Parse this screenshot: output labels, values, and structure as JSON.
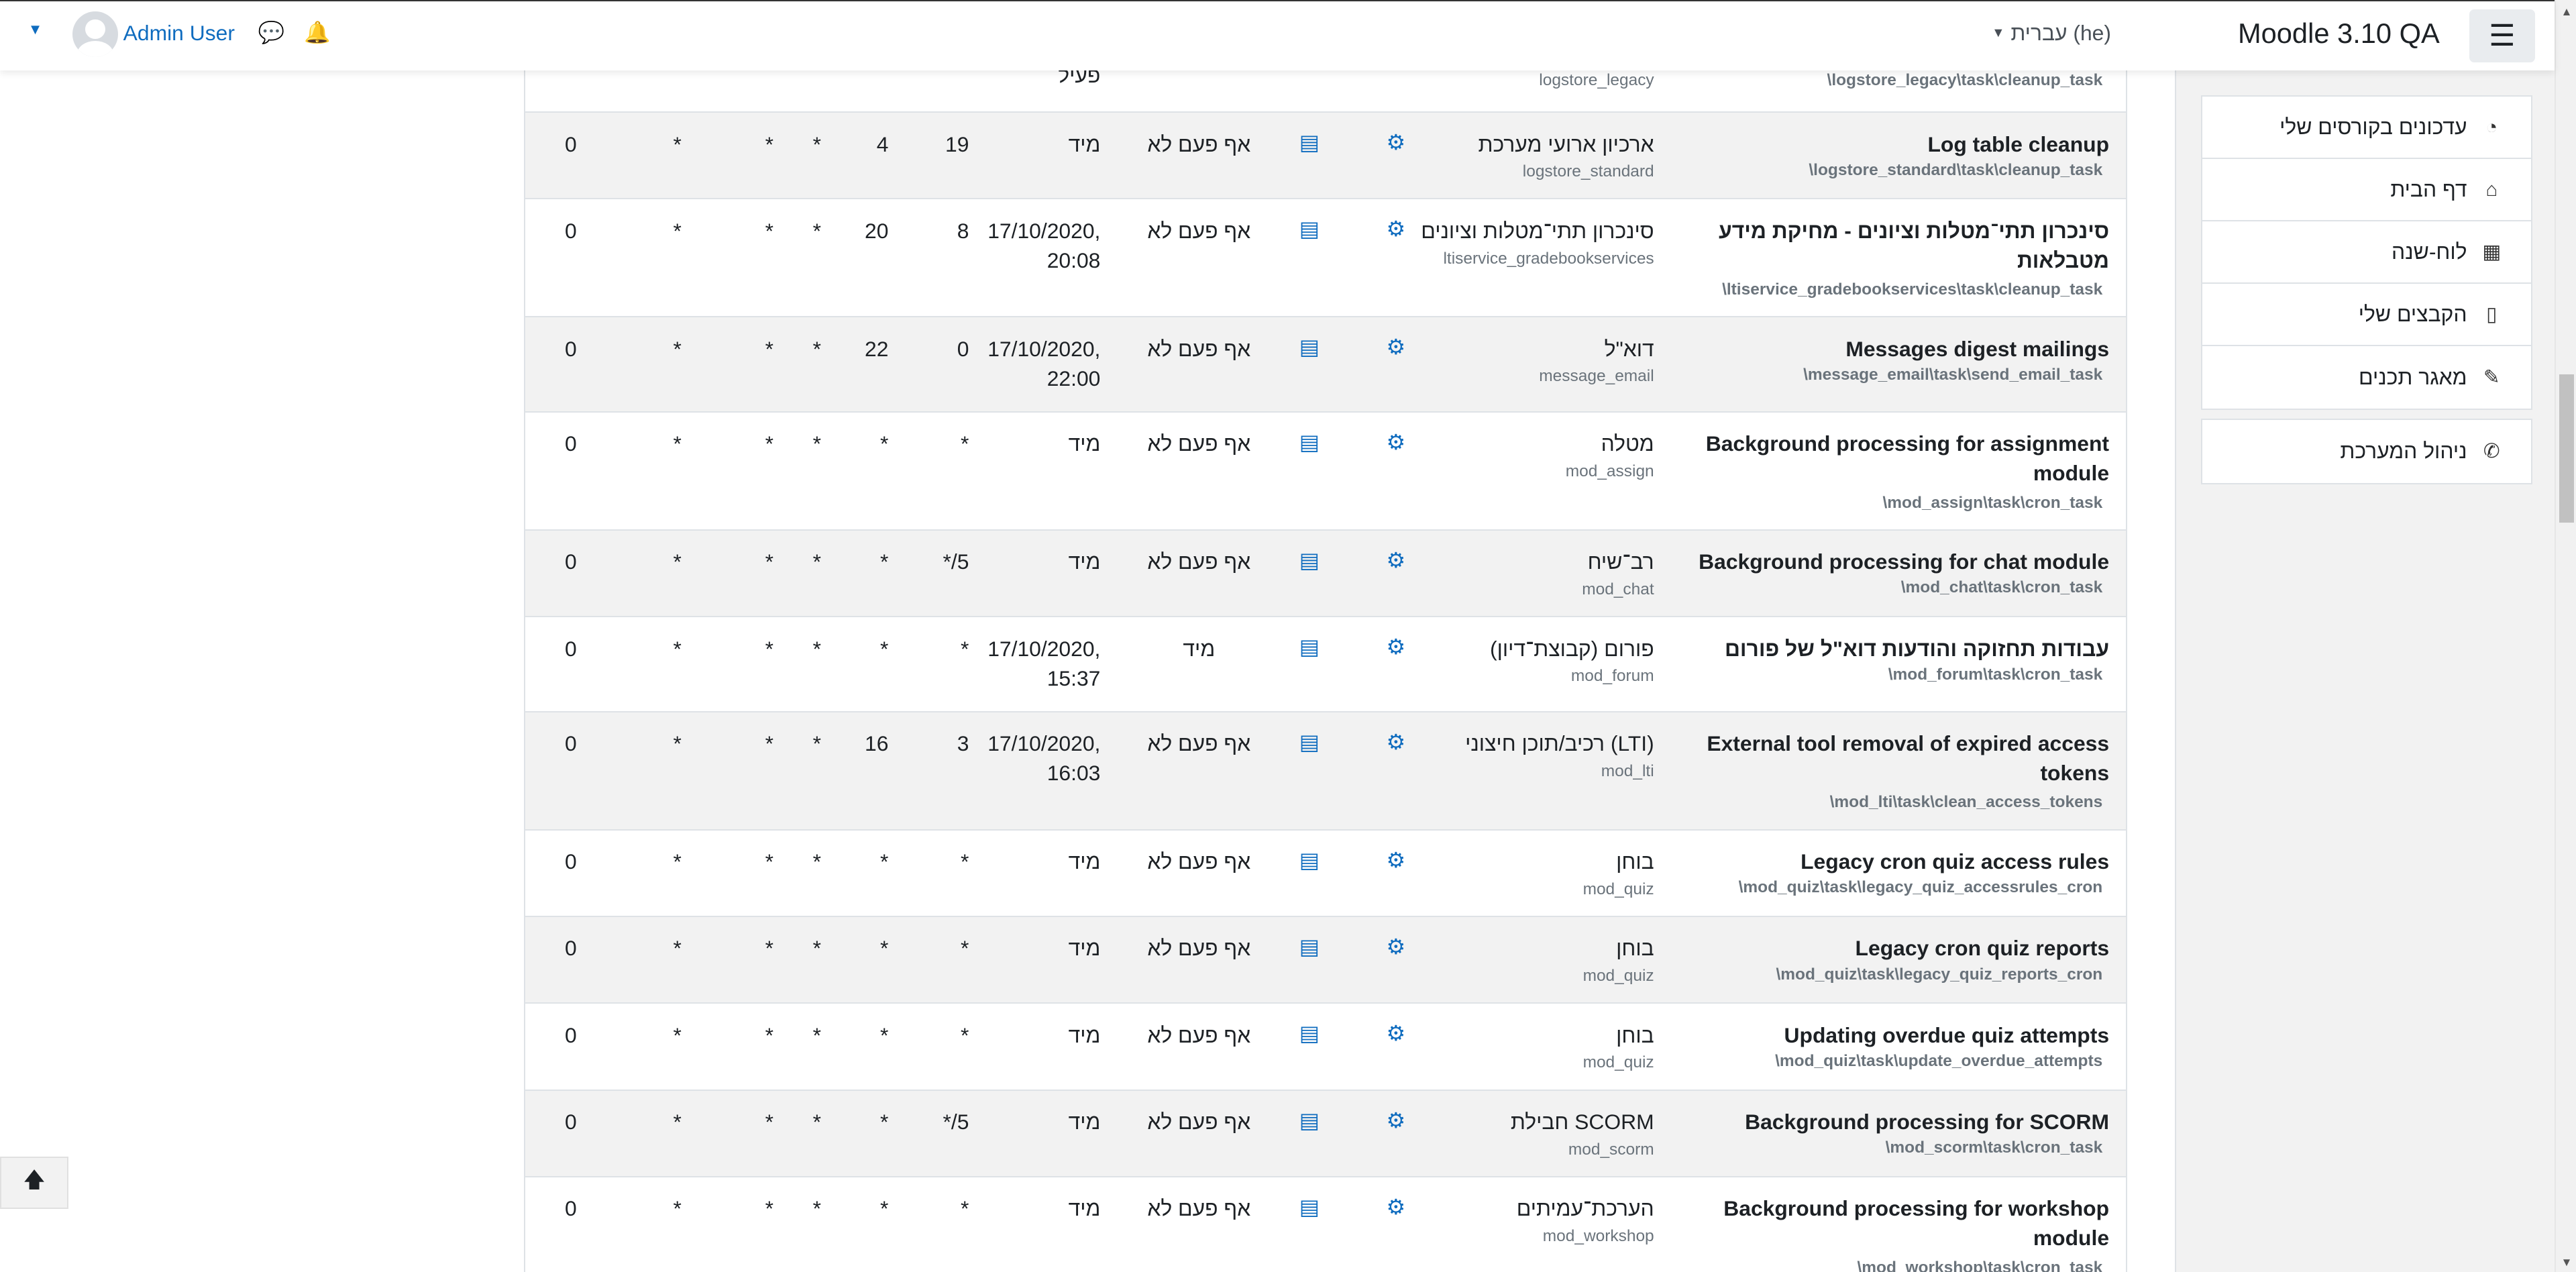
{
  "navbar": {
    "brand": "Moodle 3.10 QA",
    "language": "עברית (he)",
    "user": "Admin User"
  },
  "drawer": {
    "group1": [
      {
        "label": "עדכונים בקורסים שלי",
        "icon": "dashboard-icon",
        "glyph": "◔"
      },
      {
        "label": "דף הבית",
        "icon": "home-icon",
        "glyph": "⌂"
      },
      {
        "label": "לוח-שנה",
        "icon": "calendar-icon",
        "glyph": "▦"
      },
      {
        "label": "הקבצים שלי",
        "icon": "file-icon",
        "glyph": "▯"
      },
      {
        "label": "מאגר תכנים",
        "icon": "paintbrush-icon",
        "glyph": "✎"
      }
    ],
    "group2": [
      {
        "label": "ניהול המערכת",
        "icon": "wrench-icon",
        "glyph": "✆"
      }
    ]
  },
  "table": {
    "partial_row": {
      "path": "\\logstore_legacy\\task\\cleanup_task",
      "component_sub": "logstore_legacy",
      "status": "פעיל"
    },
    "rows": [
      {
        "name": "Log table cleanup",
        "path": "\\logstore_standard\\task\\cleanup_task",
        "component": "ארכיון ארועי מערכת",
        "component_sub": "logstore_standard",
        "last": "אף פעם לא",
        "next": "מיד",
        "next2": "",
        "minute": "19",
        "hour": "4",
        "day": "*",
        "dow": "*",
        "month": "*",
        "fail": "0"
      },
      {
        "name": "סינכרון תתי־מטלות וציונים - מחיקת מידע מטבלאות",
        "path": "\\ltiservice_gradebookservices\\task\\cleanup_task",
        "component": "סינכרון תתי־מטלות וציונים",
        "component_sub": "ltiservice_gradebookservices",
        "last": "אף פעם לא",
        "next": "17/10/2020,",
        "next2": "20:08",
        "minute": "8",
        "hour": "20",
        "day": "*",
        "dow": "*",
        "month": "*",
        "fail": "0"
      },
      {
        "name": "Messages digest mailings",
        "path": "\\message_email\\task\\send_email_task",
        "component": "דוא\"ל",
        "component_sub": "message_email",
        "last": "אף פעם לא",
        "next": "17/10/2020,",
        "next2": "22:00",
        "minute": "0",
        "hour": "22",
        "day": "*",
        "dow": "*",
        "month": "*",
        "fail": "0"
      },
      {
        "name": "Background processing for assignment module",
        "path": "\\mod_assign\\task\\cron_task",
        "component": "מטלה",
        "component_sub": "mod_assign",
        "last": "אף פעם לא",
        "next": "מיד",
        "next2": "",
        "minute": "*",
        "hour": "*",
        "day": "*",
        "dow": "*",
        "month": "*",
        "fail": "0"
      },
      {
        "name": "Background processing for chat module",
        "path": "\\mod_chat\\task\\cron_task",
        "component": "רב־שיח",
        "component_sub": "mod_chat",
        "last": "אף פעם לא",
        "next": "מיד",
        "next2": "",
        "minute": "*/5",
        "hour": "*",
        "day": "*",
        "dow": "*",
        "month": "*",
        "fail": "0"
      },
      {
        "name": "עבודות תחזוקה והודעות דוא\"ל של פורום",
        "path": "\\mod_forum\\task\\cron_task",
        "component": "פורום (קבוצת־דיון)",
        "component_sub": "mod_forum",
        "last": "מיד",
        "next": "17/10/2020,",
        "next2": "15:37",
        "minute": "*",
        "hour": "*",
        "day": "*",
        "dow": "*",
        "month": "*",
        "fail": "0",
        "swap": true
      },
      {
        "name": "External tool removal of expired access tokens",
        "path": "\\mod_lti\\task\\clean_access_tokens",
        "component": "רכיב/תוכן חיצוני (LTI)",
        "component_sub": "mod_lti",
        "last": "אף פעם לא",
        "next": "17/10/2020,",
        "next2": "16:03",
        "minute": "3",
        "hour": "16",
        "day": "*",
        "dow": "*",
        "month": "*",
        "fail": "0"
      },
      {
        "name": "Legacy cron quiz access rules",
        "path": "\\mod_quiz\\task\\legacy_quiz_accessrules_cron",
        "component": "בוחן",
        "component_sub": "mod_quiz",
        "last": "אף פעם לא",
        "next": "מיד",
        "next2": "",
        "minute": "*",
        "hour": "*",
        "day": "*",
        "dow": "*",
        "month": "*",
        "fail": "0"
      },
      {
        "name": "Legacy cron quiz reports",
        "path": "\\mod_quiz\\task\\legacy_quiz_reports_cron",
        "component": "בוחן",
        "component_sub": "mod_quiz",
        "last": "אף פעם לא",
        "next": "מיד",
        "next2": "",
        "minute": "*",
        "hour": "*",
        "day": "*",
        "dow": "*",
        "month": "*",
        "fail": "0"
      },
      {
        "name": "Updating overdue quiz attempts",
        "path": "\\mod_quiz\\task\\update_overdue_attempts",
        "component": "בוחן",
        "component_sub": "mod_quiz",
        "last": "אף פעם לא",
        "next": "מיד",
        "next2": "",
        "minute": "*",
        "hour": "*",
        "day": "*",
        "dow": "*",
        "month": "*",
        "fail": "0"
      },
      {
        "name": "Background processing for SCORM",
        "path": "\\mod_scorm\\task\\cron_task",
        "component": "חבילת SCORM",
        "component_sub": "mod_scorm",
        "last": "אף פעם לא",
        "next": "מיד",
        "next2": "",
        "minute": "*/5",
        "hour": "*",
        "day": "*",
        "dow": "*",
        "month": "*",
        "fail": "0"
      },
      {
        "name": "Background processing for workshop module",
        "path": "\\mod_workshop\\task\\cron_task",
        "component": "הערכת־עמיתים",
        "component_sub": "mod_workshop",
        "last": "אף פעם לא",
        "next": "מיד",
        "next2": "",
        "minute": "*",
        "hour": "*",
        "day": "*",
        "dow": "*",
        "month": "*",
        "fail": "0"
      }
    ]
  }
}
